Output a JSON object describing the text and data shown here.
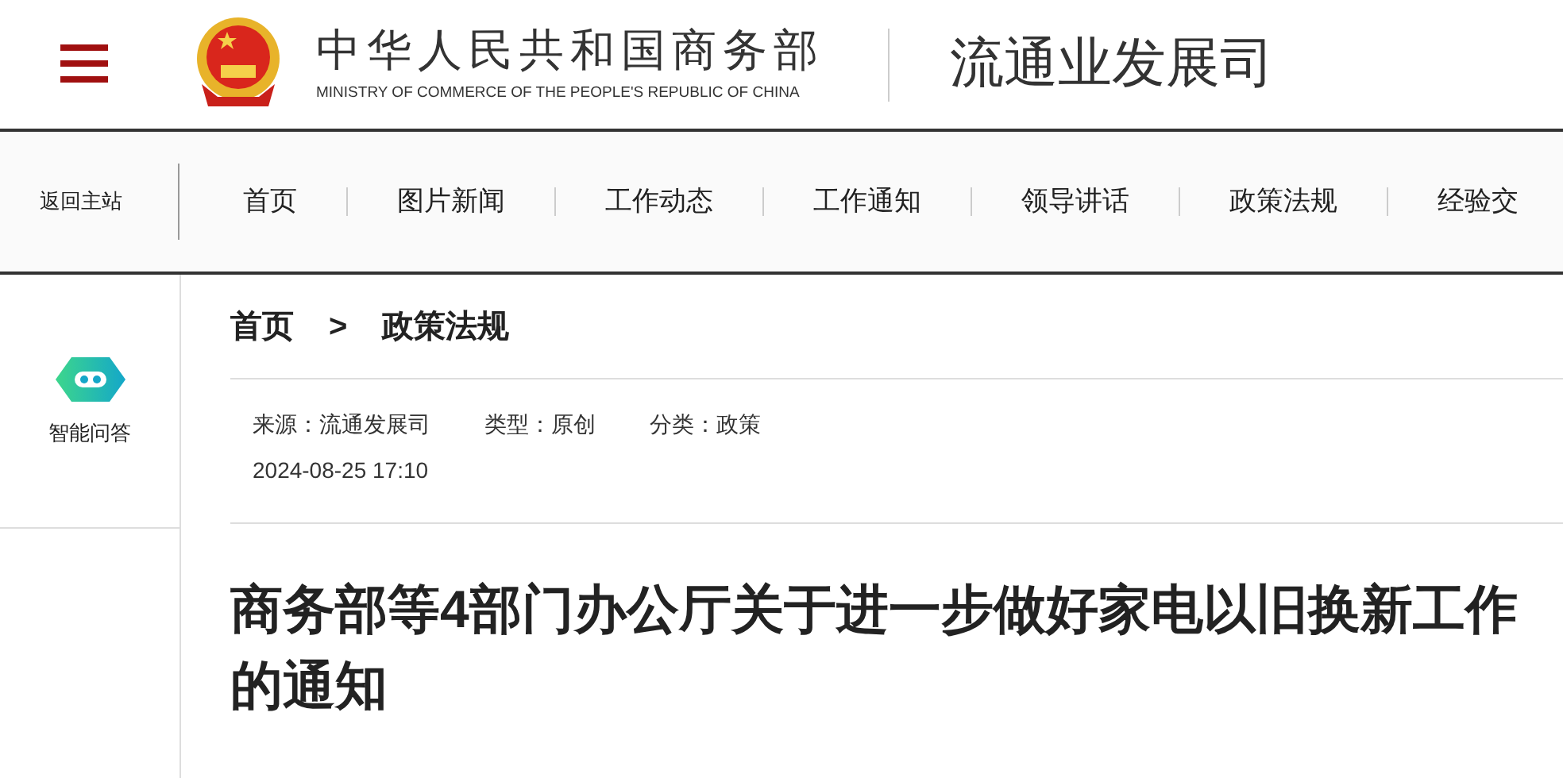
{
  "header": {
    "site_name": "中华人民共和国商务部",
    "site_name_en": "MINISTRY OF COMMERCE OF THE PEOPLE'S REPUBLIC OF CHINA",
    "department": "流通业发展司"
  },
  "nav": {
    "home_link": "返回主站",
    "items": [
      {
        "label": "首页"
      },
      {
        "label": "图片新闻"
      },
      {
        "label": "工作动态"
      },
      {
        "label": "工作通知"
      },
      {
        "label": "领导讲话"
      },
      {
        "label": "政策法规"
      },
      {
        "label": "经验交"
      }
    ]
  },
  "sidebar": {
    "items": [
      {
        "label": "智能问答"
      }
    ]
  },
  "breadcrumb": [
    {
      "label": "首页"
    },
    {
      "label": "政策法规"
    }
  ],
  "breadcrumb_separator": ">",
  "meta": [
    {
      "label": "来源：流通发展司"
    },
    {
      "label": "类型：原创"
    },
    {
      "label": "分类：政策"
    }
  ],
  "date": "2024-08-25 17:10",
  "article_title": "商务部等4部门办公厅关于进一步做好家电以旧换新工作的通知"
}
